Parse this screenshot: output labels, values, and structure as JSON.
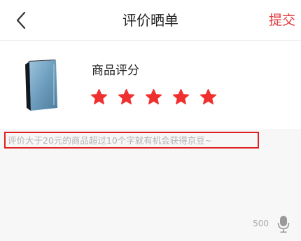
{
  "header": {
    "title": "评价晒单",
    "submit_label": "提交"
  },
  "product": {
    "rating_label": "商品评分",
    "rating": 5,
    "max_rating": 5,
    "star_color": "#f0302e"
  },
  "review": {
    "placeholder": "评价大于20元的商品超过10个字就有机会获得京豆~",
    "value": "",
    "max_chars": "500"
  },
  "colors": {
    "accent": "#e4393c",
    "input_border": "#e02020"
  },
  "icons": {
    "back": "chevron-left-icon",
    "mic": "microphone-icon",
    "star": "star-icon"
  }
}
